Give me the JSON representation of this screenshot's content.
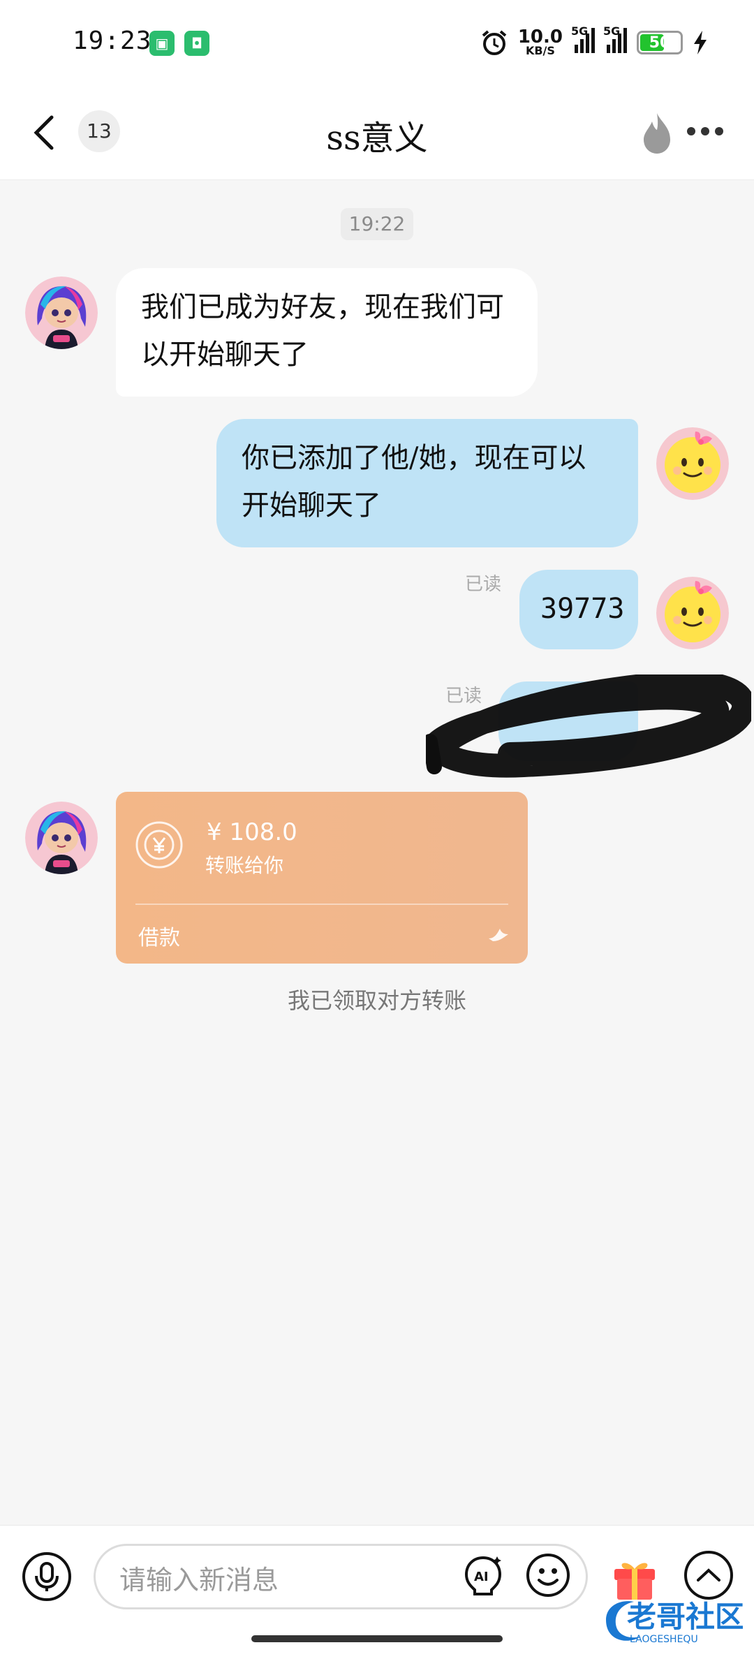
{
  "status_bar": {
    "time": "19:23",
    "net_speed": "10.0",
    "net_unit": "KB/S",
    "signal1": "5G",
    "signal2": "5G",
    "battery": "50"
  },
  "header": {
    "unread_count": "13",
    "title": "ss意义"
  },
  "chat": {
    "timestamp": "19:22",
    "messages": [
      {
        "side": "left",
        "text": "我们已成为好友，现在我们可以开始聊天了"
      },
      {
        "side": "right",
        "text": "你已添加了他/她，现在可以开始聊天了"
      },
      {
        "side": "right",
        "text": "39773",
        "read": "已读"
      },
      {
        "side": "right",
        "text": "",
        "read": "已读"
      }
    ],
    "transfer": {
      "amount": "¥ 108.0",
      "subtitle": "转账给你",
      "type": "借款"
    },
    "system_note": "我已领取对方转账"
  },
  "input": {
    "placeholder": "请输入新消息"
  },
  "watermark": {
    "title": "老哥社区",
    "sub": "LAOGESHEQU"
  },
  "colors": {
    "bubble_right": "#bfe3f6",
    "bubble_left": "#ffffff",
    "transfer_bg": "#f3b788",
    "background": "#f6f6f6"
  }
}
